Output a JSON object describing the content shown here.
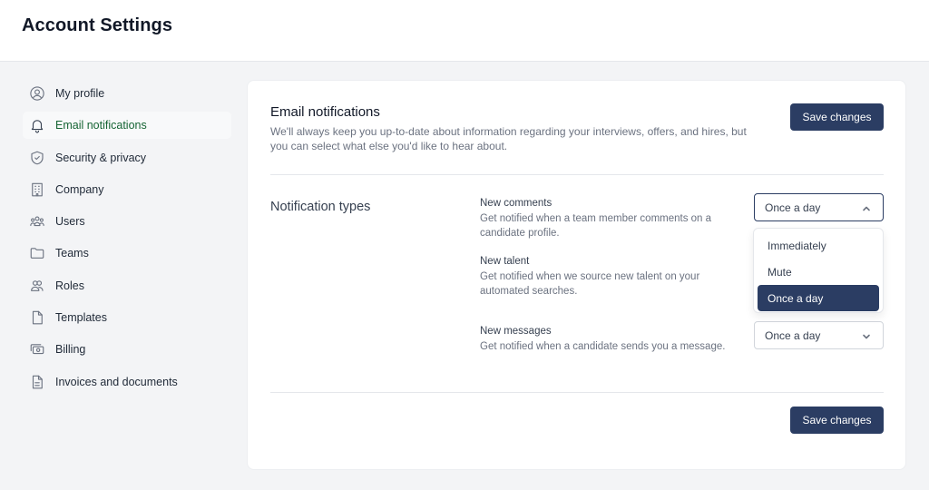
{
  "header": {
    "title": "Account Settings"
  },
  "sidebar": {
    "items": [
      {
        "label": "My profile",
        "icon": "user-circle-icon",
        "active": false
      },
      {
        "label": "Email notifications",
        "icon": "bell-icon",
        "active": true
      },
      {
        "label": "Security & privacy",
        "icon": "shield-icon",
        "active": false
      },
      {
        "label": "Company",
        "icon": "building-icon",
        "active": false
      },
      {
        "label": "Users",
        "icon": "users-icon",
        "active": false
      },
      {
        "label": "Teams",
        "icon": "folder-icon",
        "active": false
      },
      {
        "label": "Roles",
        "icon": "user-group-icon",
        "active": false
      },
      {
        "label": "Templates",
        "icon": "document-icon",
        "active": false
      },
      {
        "label": "Billing",
        "icon": "cash-icon",
        "active": false
      },
      {
        "label": "Invoices and documents",
        "icon": "document-text-icon",
        "active": false
      }
    ]
  },
  "main": {
    "title": "Email notifications",
    "description": "We'll always keep you up-to-date about information regarding your interviews, offers, and hires, but you can select what else you'd like to hear about.",
    "save_label": "Save changes",
    "section_label": "Notification types",
    "notifications": [
      {
        "title": "New comments",
        "description": "Get notified when a team member comments on a candidate profile.",
        "frequency": "Once a day"
      },
      {
        "title": "New talent",
        "description": "Get notified when we source new talent on your automated searches.",
        "frequency": "Once a day"
      },
      {
        "title": "New messages",
        "description": "Get notified when a candidate sends you a message.",
        "frequency": "Once a day"
      }
    ],
    "dropdown": {
      "options": [
        "Immediately",
        "Mute",
        "Once a day"
      ],
      "selected": "Once a day"
    }
  },
  "colors": {
    "primary": "#2b3d63",
    "active_text": "#166534",
    "background": "#f3f4f6"
  }
}
